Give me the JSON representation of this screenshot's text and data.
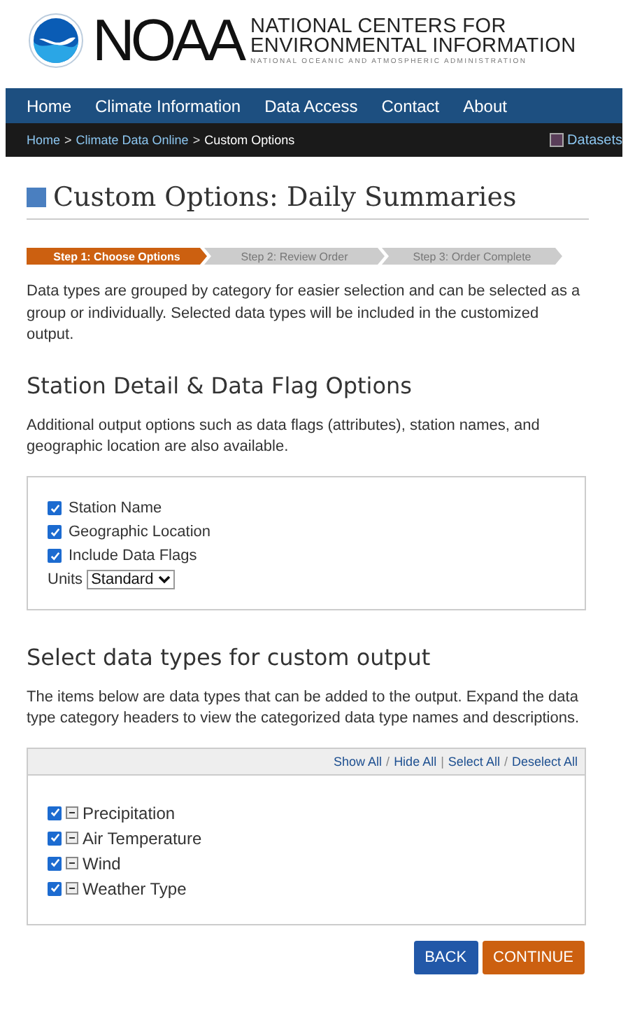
{
  "header": {
    "logo": "NOAA",
    "title_lines": [
      "NATIONAL CENTERS FOR",
      "ENVIRONMENTAL INFORMATION"
    ],
    "subtitle": "NATIONAL OCEANIC AND ATMOSPHERIC ADMINISTRATION"
  },
  "nav": [
    "Home",
    "Climate Information",
    "Data Access",
    "Contact",
    "About"
  ],
  "breadcrumb": {
    "links": [
      "Home",
      "Climate Data Online"
    ],
    "separator": ">",
    "current": "Custom Options",
    "datasets": {
      "label": "Datasets",
      "checked": false
    }
  },
  "page_title": "Custom Options: Daily Summaries",
  "steps": [
    {
      "label": "Step 1: Choose Options",
      "selected": true
    },
    {
      "label": "Step 2: Review Order",
      "selected": false
    },
    {
      "label": "Step 3: Order Complete",
      "selected": false
    }
  ],
  "intro": "Data types are grouped by category for easier selection and can be selected as a group or individually. Selected data types will be included in the customized output.",
  "station_section": {
    "heading": "Station Detail & Data Flag Options",
    "description": "Additional output options such as data flags (attributes), station names, and geographic location are also available.",
    "options": [
      {
        "label": "Station Name",
        "checked": true
      },
      {
        "label": "Geographic Location",
        "checked": true
      },
      {
        "label": "Include Data Flags",
        "checked": true
      }
    ],
    "units": {
      "label": "Units",
      "value": "Standard"
    }
  },
  "types_section": {
    "heading": "Select data types for custom output",
    "description": "The items below are data types that can be added to the output. Expand the data type category headers to view the categorized data type names and descriptions.",
    "toolbar": {
      "show_all": "Show All",
      "slash_1": "/",
      "hide_all": "Hide All",
      "pipe": "|",
      "select_all": "Select All",
      "slash_2": "/",
      "deselect_all": "Deselect All"
    },
    "categories": [
      {
        "label": "Precipitation",
        "checked": true
      },
      {
        "label": "Air Temperature",
        "checked": true
      },
      {
        "label": "Wind",
        "checked": true
      },
      {
        "label": "Weather Type",
        "checked": true
      }
    ]
  },
  "buttons": {
    "back": "BACK",
    "continue": "CONTINUE"
  }
}
